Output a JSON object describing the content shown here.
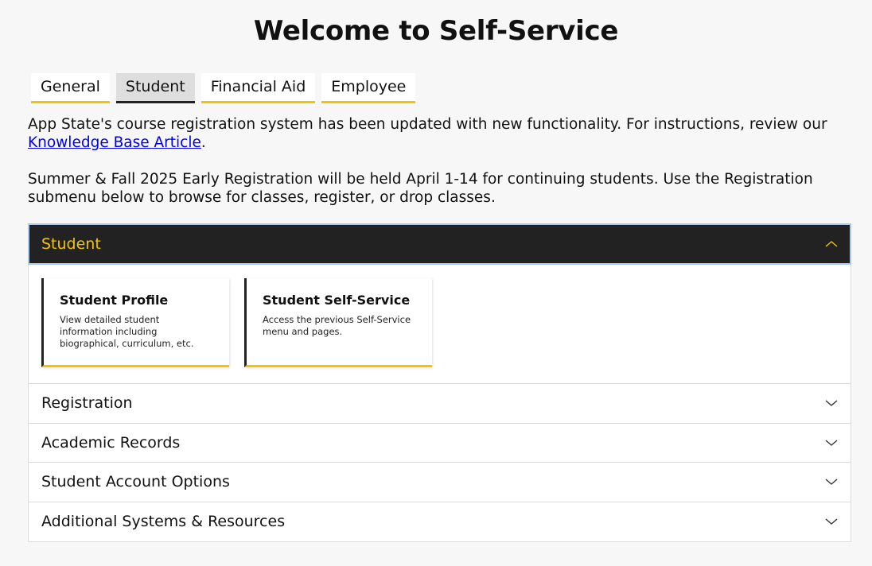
{
  "page": {
    "title": "Welcome to Self-Service"
  },
  "tabs": [
    {
      "label": "General"
    },
    {
      "label": "Student"
    },
    {
      "label": "Financial Aid"
    },
    {
      "label": "Employee"
    }
  ],
  "active_tab": "Student",
  "intro": {
    "p1_text": "App State's course registration system has been updated with new functionality. For instructions, review our",
    "p1_link": "Knowledge Base Article",
    "p1_end": ".",
    "p2_text": "Summer & Fall 2025 Early Registration will be held April 1-14 for continuing students. Use the Registration submenu below to browse for classes, register, or drop classes."
  },
  "accordion": {
    "open_section": {
      "label": "Student",
      "cards": [
        {
          "title": "Student Profile",
          "description": "View detailed student information including biographical, curriculum, etc."
        },
        {
          "title": "Student Self-Service",
          "description": "Access the previous Self-Service menu and pages."
        }
      ]
    },
    "sections": [
      {
        "label": "Registration"
      },
      {
        "label": "Academic Records"
      },
      {
        "label": "Student Account Options"
      },
      {
        "label": "Additional Systems & Resources"
      }
    ]
  },
  "colors": {
    "accent": "#f5c400",
    "header_dark": "#222222",
    "link": "#0000ee"
  },
  "icons": {
    "expanded": "chevron-up-icon",
    "collapsed": "chevron-down-icon"
  }
}
